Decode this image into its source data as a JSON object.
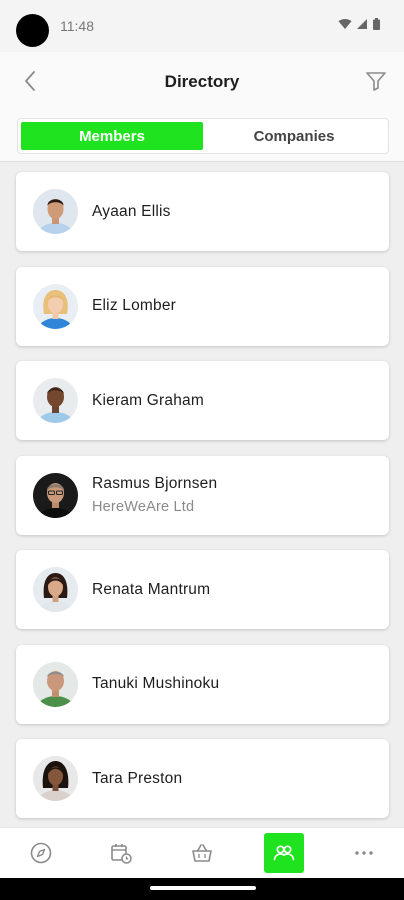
{
  "status_bar": {
    "time": "11:48"
  },
  "header": {
    "title": "Directory",
    "back_icon": "chevron-left-icon",
    "filter_icon": "filter-icon"
  },
  "tabs": [
    {
      "label": "Members",
      "active": true
    },
    {
      "label": "Companies",
      "active": false
    }
  ],
  "members": [
    {
      "name": "Ayaan Ellis",
      "company": ""
    },
    {
      "name": "Eliz Lomber",
      "company": ""
    },
    {
      "name": "Kieram Graham",
      "company": ""
    },
    {
      "name": "Rasmus Bjornsen",
      "company": "HereWeAre Ltd"
    },
    {
      "name": "Renata Mantrum",
      "company": ""
    },
    {
      "name": "Tanuki Mushinoku",
      "company": ""
    },
    {
      "name": "Tara Preston",
      "company": ""
    }
  ],
  "bottom_nav": [
    {
      "icon": "compass-icon",
      "active": false
    },
    {
      "icon": "calendar-clock-icon",
      "active": false
    },
    {
      "icon": "basket-icon",
      "active": false
    },
    {
      "icon": "people-icon",
      "active": true
    },
    {
      "icon": "more-icon",
      "active": false
    }
  ],
  "colors": {
    "accent": "#1ee31e",
    "background": "#efefef",
    "secondary_text": "#8a8a8a"
  }
}
